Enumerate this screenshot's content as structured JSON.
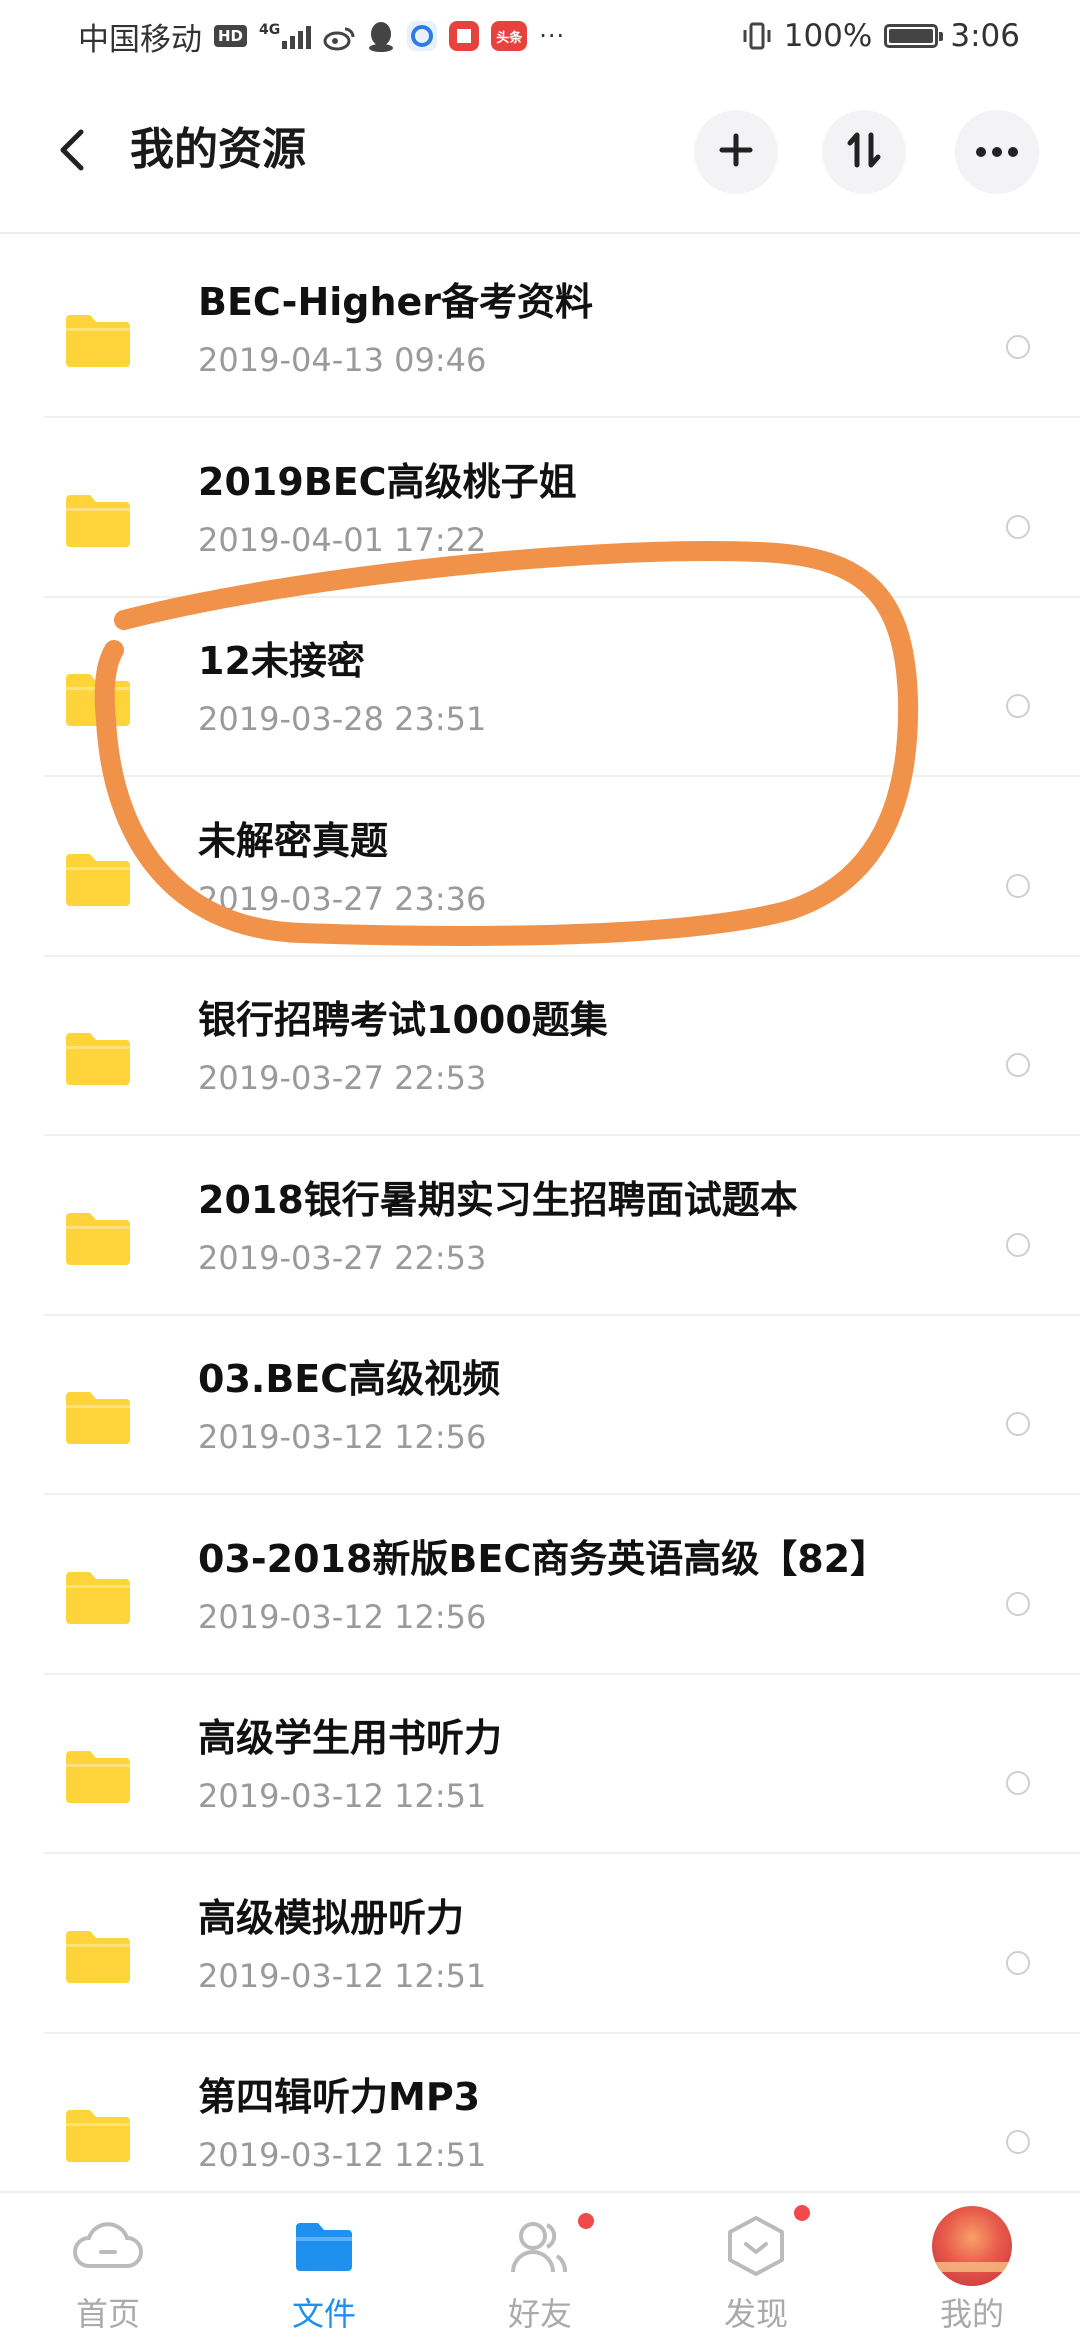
{
  "status_bar": {
    "carrier": "中国移动",
    "hd_badge": "HD",
    "network": "4G",
    "battery_text": "100%",
    "battery_level": 1.0,
    "time": "3:06",
    "icons": [
      "hd-icon",
      "signal-icon",
      "weibo-icon",
      "qq-icon",
      "browser-icon",
      "reader-icon",
      "toutiao-icon",
      "more-notifications-icon",
      "vibrate-icon",
      "battery-icon"
    ],
    "toutiao_label": "头条",
    "more_label": "···"
  },
  "header": {
    "title": "我的资源",
    "icons": [
      "back-icon",
      "add-icon",
      "sort-icon",
      "more-icon"
    ]
  },
  "files": [
    {
      "name": "BEC-Higher备考资料",
      "date": "2019-04-13  09:46"
    },
    {
      "name": "2019BEC高级桃子姐",
      "date": "2019-04-01  17:22"
    },
    {
      "name": "12未接密",
      "date": "2019-03-28  23:51"
    },
    {
      "name": "未解密真题",
      "date": "2019-03-27  23:36"
    },
    {
      "name": "银行招聘考试1000题集",
      "date": "2019-03-27  22:53"
    },
    {
      "name": "2018银行暑期实习生招聘面试题本",
      "date": "2019-03-27  22:53"
    },
    {
      "name": "03.BEC高级视频",
      "date": "2019-03-12  12:56"
    },
    {
      "name": "03-2018新版BEC商务英语高级【82】",
      "date": "2019-03-12  12:56"
    },
    {
      "name": "高级学生用书听力",
      "date": "2019-03-12  12:51"
    },
    {
      "name": "高级模拟册听力",
      "date": "2019-03-12  12:51"
    },
    {
      "name": "第四辑听力MP3",
      "date": "2019-03-12  12:51"
    }
  ],
  "annotation_color": "#f0924a",
  "folder_color": "#ffd43b",
  "accent_color": "#1e90f0",
  "tab_bar": {
    "tabs": [
      {
        "label": "首页",
        "icon": "cloud-icon",
        "active": false,
        "badge": false
      },
      {
        "label": "文件",
        "icon": "folder-icon",
        "active": true,
        "badge": false
      },
      {
        "label": "好友",
        "icon": "friends-icon",
        "active": false,
        "badge": true
      },
      {
        "label": "发现",
        "icon": "discover-icon",
        "active": false,
        "badge": true
      },
      {
        "label": "我的",
        "icon": "avatar-icon",
        "active": false,
        "badge": false
      }
    ]
  }
}
